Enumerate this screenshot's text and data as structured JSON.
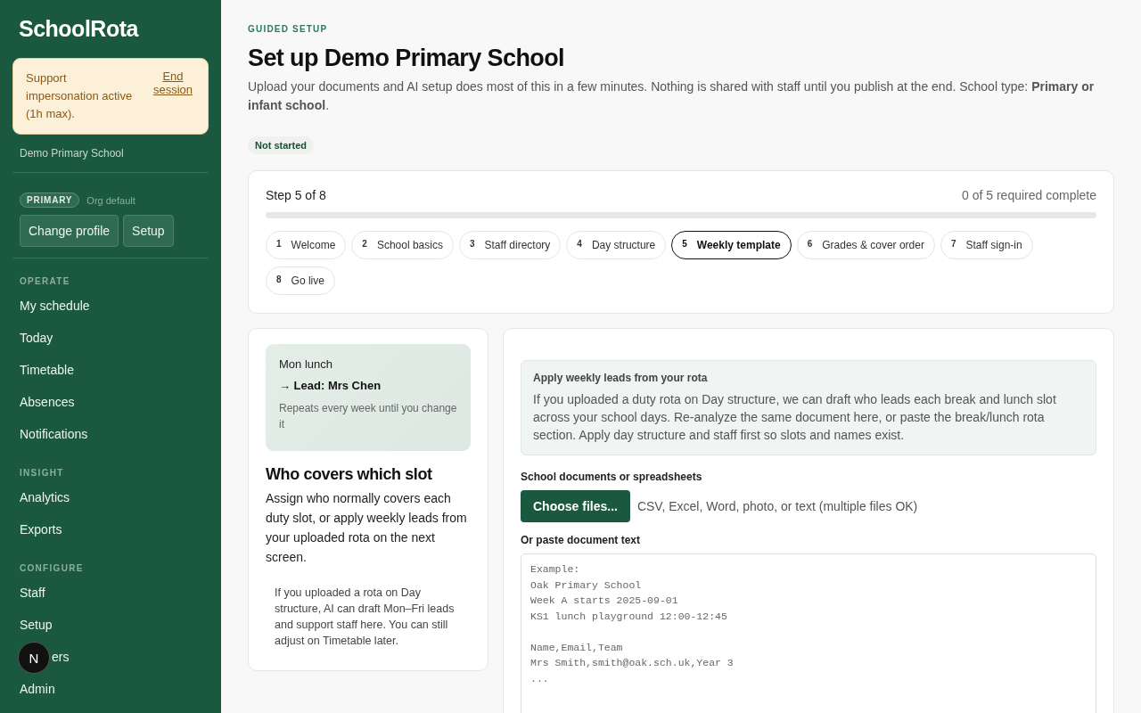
{
  "sidebar": {
    "logo": "SchoolRota",
    "notice": {
      "text": "Support impersonation active (1h max).",
      "link": "End session"
    },
    "school": "Demo Primary School",
    "profile": {
      "badge": "PRIMARY",
      "note": "Org default"
    },
    "buttons": [
      "Change profile",
      "Setup"
    ],
    "sections": [
      {
        "heading": "OPERATE",
        "items": [
          {
            "label": "My schedule"
          },
          {
            "label": "Today"
          },
          {
            "label": "Timetable"
          },
          {
            "label": "Absences"
          },
          {
            "label": "Notifications"
          }
        ]
      },
      {
        "heading": "INSIGHT",
        "items": [
          {
            "label": "Analytics"
          },
          {
            "label": "Exports"
          }
        ]
      },
      {
        "heading": "CONFIGURE",
        "items": [
          {
            "label": "Staff"
          },
          {
            "label": "Setup"
          },
          {
            "label": "ers",
            "covered": true
          },
          {
            "label": "Admin"
          }
        ]
      }
    ],
    "floating_badge": "N"
  },
  "header": {
    "eyebrow": "GUIDED SETUP",
    "title": "Set up Demo Primary School",
    "description": "Upload your documents and AI setup does most of this in a few minutes. Nothing is shared with staff until you publish at the end. School type: **Primary or infant school**.",
    "status": "Not started"
  },
  "stepper": {
    "step_label": "Step 5 of 8",
    "progress_label": "0 of 5 required complete",
    "level": 0,
    "steps": [
      {
        "number": "1",
        "label": "Welcome",
        "selected": false
      },
      {
        "number": "2",
        "label": "School basics",
        "selected": false
      },
      {
        "number": "3",
        "label": "Staff directory",
        "selected": false
      },
      {
        "number": "4",
        "label": "Day structure",
        "selected": false
      },
      {
        "number": "5",
        "label": "Weekly template",
        "selected": true
      },
      {
        "number": "6",
        "label": "Grades & cover order",
        "selected": false
      },
      {
        "number": "7",
        "label": "Staff sign-in",
        "selected": false
      },
      {
        "number": "8",
        "label": "Go live",
        "selected": false
      }
    ]
  },
  "intro_card": {
    "preview": {
      "slot": "Mon lunch",
      "lead": "→ Lead: Mrs Chen",
      "note": "Repeats every week until you change it"
    },
    "title": "Who covers which slot",
    "body": "Assign who normally covers each duty slot, or apply weekly leads from your uploaded rota on the next screen.",
    "tip": "If you uploaded a rota on Day structure, AI can draft Mon–Fri leads and support staff here. You can still adjust on Timetable later."
  },
  "import_card": {
    "info": {
      "title": "Apply weekly leads from your rota",
      "body": "If you uploaded a duty rota on Day structure, we can draft who leads each break and lunch slot across your school days. Re-analyze the same document here, or paste the break/lunch rota section. Apply day structure and staff first so slots and names exist."
    },
    "files_label": "School documents or spreadsheets",
    "choose_button": "Choose files...",
    "files_hint": "CSV, Excel, Word, photo, or text (multiple files OK)",
    "paste_label": "Or paste document text",
    "placeholder": "Example:\nOak Primary School\nWeek A starts 2025-09-01\nKS1 lunch playground 12:00-12:45\n\nName,Email,Team\nMrs Smith,smith@oak.sch.uk,Year 3\n..."
  }
}
